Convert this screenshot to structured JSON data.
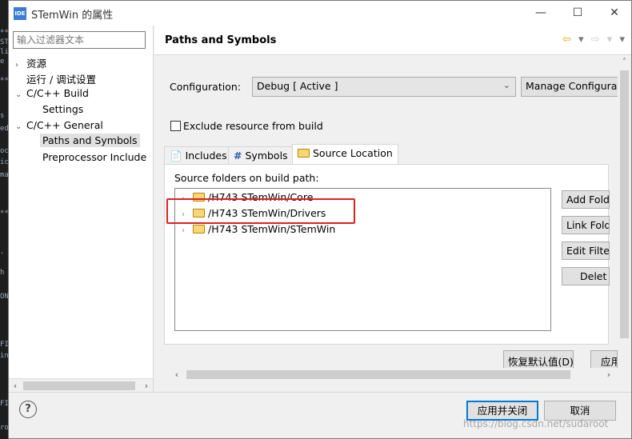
{
  "background_code": [
    {
      "text": "**"
    },
    {
      "text": "ST"
    },
    {
      "text": "lic"
    },
    {
      "text": "e"
    },
    {
      "text": "**"
    },
    {
      "text": "s"
    },
    {
      "text": "ed"
    },
    {
      "text": "oc"
    },
    {
      "text": "ic"
    },
    {
      "text": "ma"
    },
    {
      "text": "**"
    },
    {
      "text": "."
    },
    {
      "text": "h"
    },
    {
      "text": "ON"
    },
    {
      "text": "FI"
    },
    {
      "text": "int"
    },
    {
      "text": "FI"
    },
    {
      "text": "ro"
    }
  ],
  "window": {
    "icon_text": "IDE",
    "title": "STemWin 的属性",
    "controls": {
      "minimize": "—",
      "maximize": "☐",
      "close": "✕"
    }
  },
  "sidebar": {
    "filter_placeholder": "输入过滤器文本",
    "tree": [
      {
        "label": "资源",
        "expand": "›"
      },
      {
        "label": "运行 / 调试设置",
        "expand": ""
      },
      {
        "label": "C/C++ Build",
        "expand": "⌄"
      },
      {
        "label": "Settings",
        "expand": ""
      },
      {
        "label": "C/C++ General",
        "expand": "⌄"
      },
      {
        "label": "Paths and Symbols",
        "expand": "",
        "selected": true
      },
      {
        "label": "Preprocessor Include",
        "expand": ""
      }
    ],
    "scroll_left": "‹",
    "scroll_right": "›"
  },
  "page": {
    "title": "Paths and Symbols",
    "nav": {
      "back": "⇦",
      "back_menu": "▾",
      "forward": "⇨",
      "forward_menu": "▾",
      "view_menu": "▾"
    }
  },
  "config": {
    "label": "Configuration:",
    "value": "Debug  [ Active ]",
    "manage_button": "Manage Configurati"
  },
  "exclude_checkbox": {
    "label": "Exclude resource from build",
    "checked": false
  },
  "tabs": [
    {
      "label": "Includes",
      "icon": "includes-icon"
    },
    {
      "label": "Symbols",
      "icon": "hash-icon",
      "glyph": "#"
    },
    {
      "label": "Source Location",
      "icon": "folder-icon",
      "active": true
    }
  ],
  "source": {
    "label": "Source folders on build path:",
    "folders": [
      {
        "path": "/H743 STemWin/Core"
      },
      {
        "path": "/H743 STemWin/Drivers"
      },
      {
        "path": "/H743 STemWin/STemWin"
      }
    ],
    "buttons": {
      "add": "Add Fold",
      "link": "Link Fold",
      "edit": "Edit Filte",
      "delete": "Delet"
    }
  },
  "restore_button": "恢复默认值(D)",
  "apply_button": "应用",
  "footer": {
    "help": "?",
    "apply_close": "应用并关闭",
    "cancel": "取消",
    "watermark": "https://blog.csdn.net/sudaroot"
  },
  "colors": {
    "highlight": "#e02020",
    "primary_border": "#0078d7"
  }
}
